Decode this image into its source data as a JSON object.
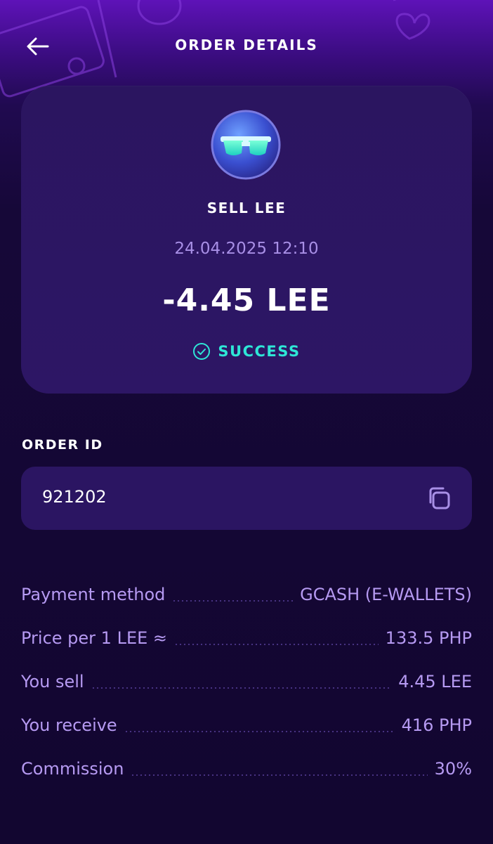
{
  "header": {
    "title": "ORDER DETAILS"
  },
  "order": {
    "title": "SELL LEE",
    "datetime": "24.04.2025 12:10",
    "amount": "-4.45 LEE",
    "status": "SUCCESS"
  },
  "order_id": {
    "label": "ORDER ID",
    "value": "921202"
  },
  "details": [
    {
      "label": "Payment method",
      "value": "GCASH (E-WALLETS)"
    },
    {
      "label": "Price per 1 LEE ≈",
      "value": "133.5 PHP"
    },
    {
      "label": "You sell",
      "value": "4.45 LEE"
    },
    {
      "label": "You receive",
      "value": "416 PHP"
    },
    {
      "label": "Commission",
      "value": "30%"
    }
  ],
  "colors": {
    "accent_success": "#2ee6d6",
    "text_muted": "#b69af2",
    "card_bg": "#2b1560",
    "page_bg": "#120630"
  },
  "icons": {
    "back": "arrow-left-icon",
    "avatar": "sunglasses-avatar-icon",
    "status": "check-circle-icon",
    "copy": "copy-icon"
  }
}
